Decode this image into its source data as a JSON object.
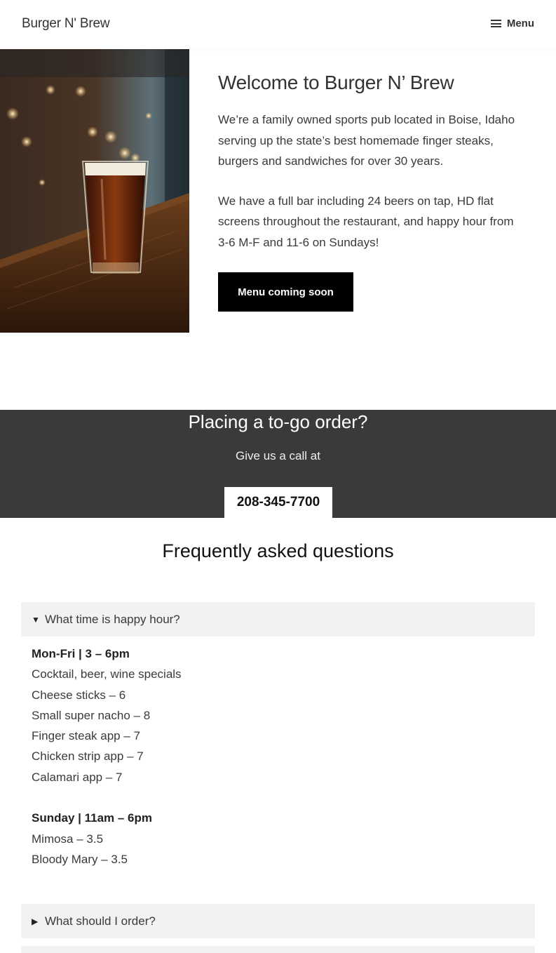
{
  "header": {
    "site_title": "Burger N' Brew",
    "menu_label": "Menu"
  },
  "hero": {
    "image_alt": "Glass of beer on a wooden bar counter",
    "title": "Welcome to Burger N’ Brew",
    "paragraph1": "We’re a family owned sports pub located in Boise, Idaho serving up the state’s best homemade finger steaks, burgers and sandwiches for over 30 years.",
    "paragraph2": "We have a full bar including 24 beers on tap, HD flat screens throughout the restaurant, and happy hour from 3-6 M-F and 11-6 on Sundays!",
    "button_label": "Menu coming soon"
  },
  "order": {
    "title": "Placing a to-go order?",
    "subtitle": "Give us a call at",
    "phone": "208-345-7700"
  },
  "faq": {
    "title": "Frequently asked questions",
    "items": [
      {
        "question": "What time is happy hour?",
        "expanded": true,
        "weekday_heading": "Mon-Fri | 3 – 6pm",
        "weekday_lines": [
          "Cocktail, beer, wine specials",
          "Cheese sticks – 6",
          "Small super nacho – 8",
          "Finger steak app – 7",
          "Chicken strip app – 7",
          "Calamari app – 7"
        ],
        "sunday_heading": "Sunday | 11am – 6pm",
        "sunday_lines": [
          "Mimosa – 3.5",
          "Bloody Mary – 3.5"
        ]
      },
      {
        "question": "What should I order?",
        "expanded": false
      }
    ]
  },
  "colors": {
    "dark_band": "#3a3a3a",
    "button_black": "#000000",
    "faq_bg": "#f2f2f2"
  }
}
